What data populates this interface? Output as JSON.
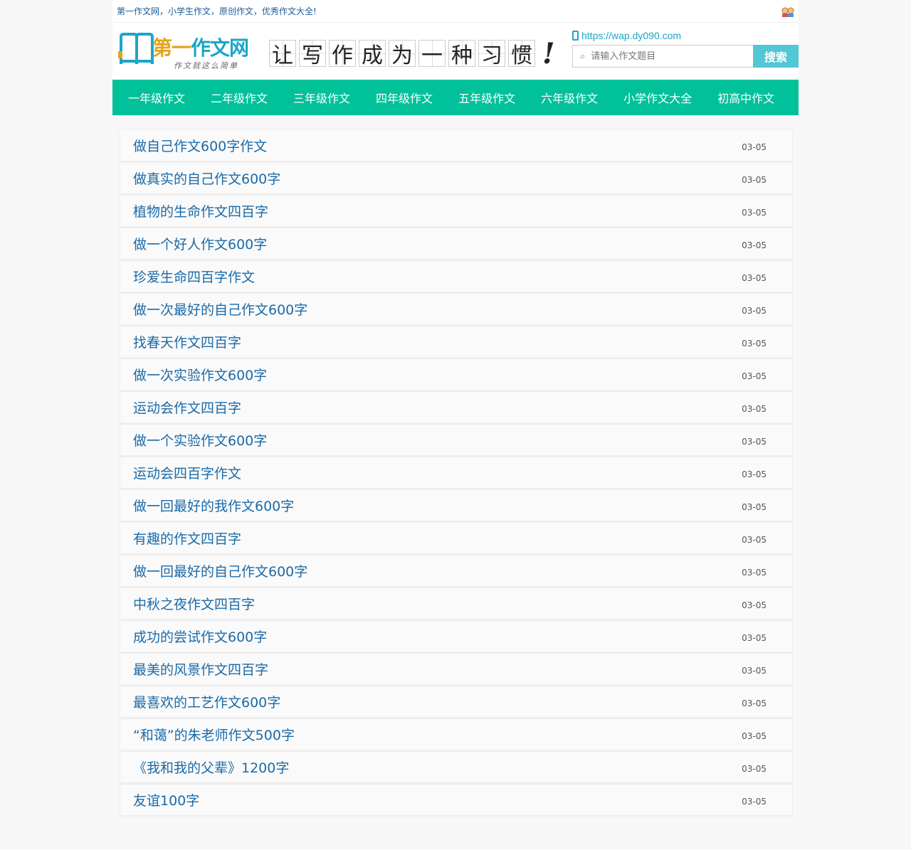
{
  "topbar": {
    "slogan": "第一作文网，小学生作文，原创作文，优秀作文大全!"
  },
  "header": {
    "logo_text_first": "第一",
    "logo_text_rest": "作文网",
    "logo_sub": "作文就这么简单",
    "motto_chars": [
      "让",
      "写",
      "作",
      "成",
      "为",
      "一",
      "种",
      "习",
      "惯"
    ],
    "motto_excl": "!",
    "mobile_link": "https://wap.dy090.com",
    "search_placeholder": "请输入作文题目",
    "search_button": "搜索"
  },
  "nav": {
    "items": [
      "一年级作文",
      "二年级作文",
      "三年级作文",
      "四年级作文",
      "五年级作文",
      "六年级作文",
      "小学作文大全",
      "初高中作文"
    ]
  },
  "articles": [
    {
      "title": "做自己作文600字作文",
      "date": "03-05"
    },
    {
      "title": "做真实的自己作文600字",
      "date": "03-05"
    },
    {
      "title": "植物的生命作文四百字",
      "date": "03-05"
    },
    {
      "title": "做一个好人作文600字",
      "date": "03-05"
    },
    {
      "title": "珍爱生命四百字作文",
      "date": "03-05"
    },
    {
      "title": "做一次最好的自己作文600字",
      "date": "03-05"
    },
    {
      "title": "找春天作文四百字",
      "date": "03-05"
    },
    {
      "title": "做一次实验作文600字",
      "date": "03-05"
    },
    {
      "title": "运动会作文四百字",
      "date": "03-05"
    },
    {
      "title": "做一个实验作文600字",
      "date": "03-05"
    },
    {
      "title": "运动会四百字作文",
      "date": "03-05"
    },
    {
      "title": "做一回最好的我作文600字",
      "date": "03-05"
    },
    {
      "title": "有趣的作文四百字",
      "date": "03-05"
    },
    {
      "title": "做一回最好的自己作文600字",
      "date": "03-05"
    },
    {
      "title": "中秋之夜作文四百字",
      "date": "03-05"
    },
    {
      "title": "成功的尝试作文600字",
      "date": "03-05"
    },
    {
      "title": "最美的风景作文四百字",
      "date": "03-05"
    },
    {
      "title": "最喜欢的工艺作文600字",
      "date": "03-05"
    },
    {
      "title": "“和蔼”的朱老师作文500字",
      "date": "03-05"
    },
    {
      "title": "《我和我的父辈》1200字",
      "date": "03-05"
    },
    {
      "title": "友谊100字",
      "date": "03-05"
    }
  ],
  "colors": {
    "nav_bg": "#00c19a",
    "link": "#1a6aa8",
    "accent": "#1aa6c8",
    "search_button": "#52c7d6"
  }
}
